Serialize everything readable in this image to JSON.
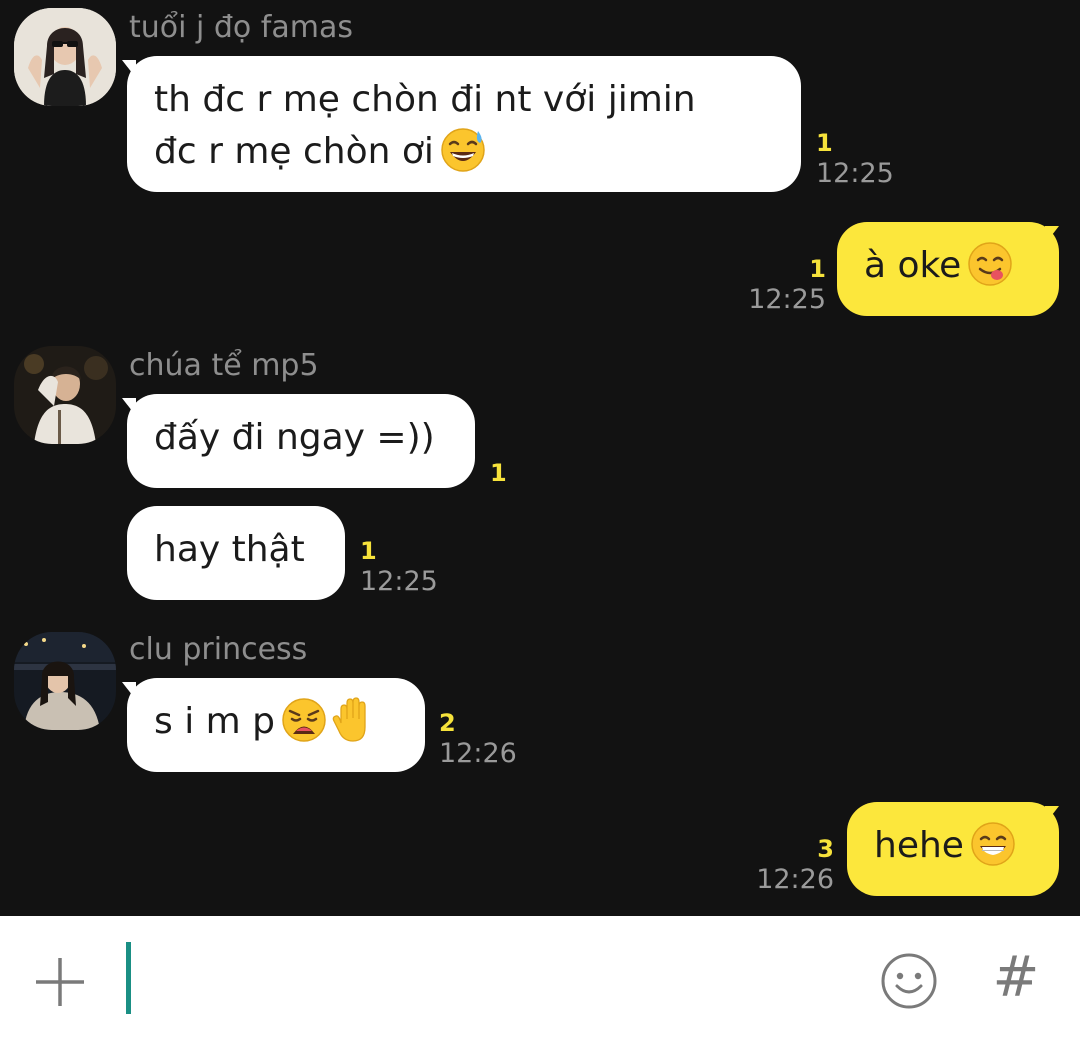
{
  "messages": [
    {
      "sender": "tuổi j đọ famas",
      "direction": "incoming",
      "lines": [
        "th đc r mẹ chòn đi nt với jimin",
        "đc r mẹ chòn ơi"
      ],
      "emoji": "grinning-sweat-emoji",
      "unread": "1",
      "time": "12:25"
    },
    {
      "direction": "outgoing",
      "text": "à oke",
      "emoji": "yum-emoji",
      "unread": "1",
      "time": "12:25"
    },
    {
      "sender": "chúa tể mp5",
      "direction": "incoming",
      "text": "đấy đi ngay =))",
      "unread": "1"
    },
    {
      "direction": "incoming",
      "text": "hay thật",
      "unread": "1",
      "time": "12:25"
    },
    {
      "sender": "clu princess",
      "direction": "incoming",
      "text": "s i m p",
      "emoji": "weary-face-and-raised-hand-emoji",
      "unread": "2",
      "time": "12:26"
    },
    {
      "direction": "outgoing",
      "text": "hehe",
      "emoji": "beaming-face-emoji",
      "unread": "3",
      "time": "12:26"
    }
  ],
  "composer": {
    "placeholder": "",
    "plus_icon": "plus-icon",
    "emoji_icon": "smiley-icon",
    "hashtag_label": "#"
  },
  "colors": {
    "background": "#121212",
    "incoming_bubble": "#ffffff",
    "outgoing_bubble": "#fce73c",
    "unread": "#f6e23b",
    "time": "#9a9a9a",
    "sender": "#8e8e8e",
    "cursor": "#1a8f84"
  }
}
